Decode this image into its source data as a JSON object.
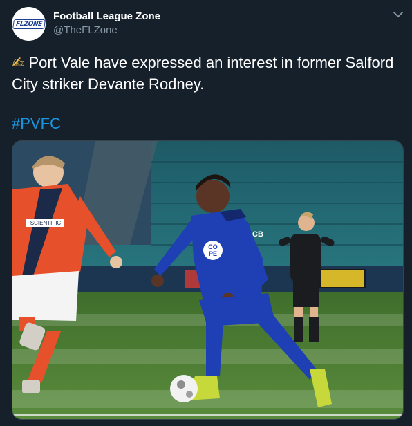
{
  "account": {
    "display_name": "Football League Zone",
    "handle": "@TheFLZone",
    "avatar_text": "FLZONE"
  },
  "tweet": {
    "emoji": "✍",
    "text": "Port Vale have expressed an interest in former Salford City striker Devante Rodney.",
    "hashtag": "#PVFC"
  },
  "photo": {
    "shirt_sponsor_left": "SCIENTIFIC",
    "shirt_sponsor_right_line1": "CO",
    "shirt_sponsor_right_line2": "PE",
    "sleeve_text": "CB"
  },
  "colors": {
    "background": "#15202b",
    "secondary_text": "#8899a6",
    "link": "#1b95e0",
    "pitch": "#4a7a34",
    "home_kit": "#1f3fb5",
    "away_kit": "#e6502a"
  },
  "icons": {
    "menu": "chevron-down-icon"
  }
}
